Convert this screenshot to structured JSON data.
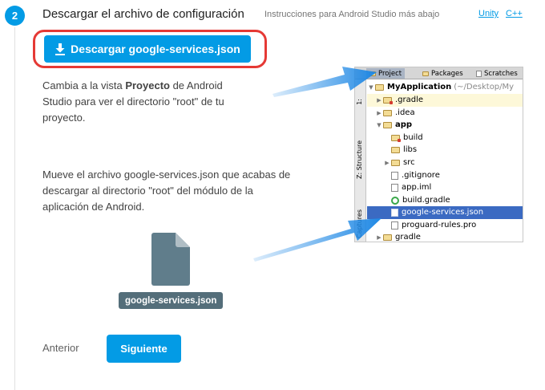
{
  "step": {
    "number": "2",
    "title": "Descargar el archivo de configuración",
    "subtitle": "Instrucciones para Android Studio más abajo",
    "links": [
      "Unity",
      "C++"
    ]
  },
  "download_button": {
    "label": "Descargar google-services.json",
    "icon": "download-icon"
  },
  "instructions": {
    "p1_before": "Cambia a la vista ",
    "p1_bold": "Proyecto",
    "p1_after": " de Android Studio para ver el directorio \"root\" de tu proyecto.",
    "p2": "Mueve el archivo google-services.json que acabas de descargar al directorio \"root\" del módulo de la aplicación de Android."
  },
  "file": {
    "label": "google-services.json",
    "icon": "file-icon"
  },
  "nav": {
    "prev_label": "Anterior",
    "next_label": "Siguiente"
  },
  "android_studio": {
    "tabs": [
      "Project",
      "Packages",
      "Scratches"
    ],
    "side_tabs": [
      "1:",
      "Z: Structure",
      "Captures"
    ],
    "tree": {
      "root": "MyApplication",
      "root_path": "(~/Desktop/My",
      "items": [
        ".gradle",
        ".idea",
        "app",
        "build",
        "libs",
        "src",
        ".gitignore",
        "app.iml",
        "build.gradle",
        "google-services.json",
        "proguard-rules.pro",
        "gradle"
      ]
    }
  },
  "colors": {
    "accent": "#039be5",
    "highlight_ring": "#e53935",
    "arrow": "#1e88e5",
    "file_icon": "#607d8b"
  }
}
